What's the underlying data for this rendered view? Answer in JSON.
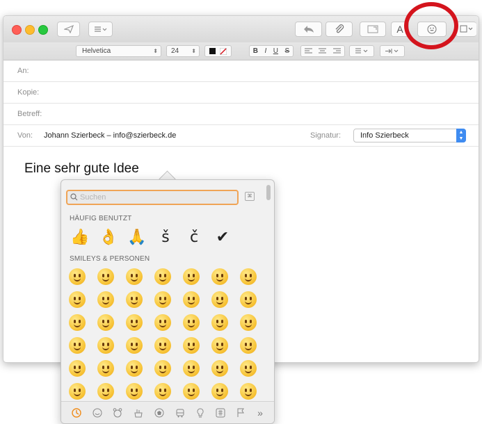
{
  "toolbar": {
    "send_icon": "paper-plane-icon",
    "header_fields_icon": "list-icon",
    "reply_icon": "reply-arrow-icon",
    "attach_icon": "paperclip-icon",
    "photo_icon": "photo-browser-icon",
    "format_label": "A",
    "emoji_icon": "smiley-icon",
    "more_icon": "photo-dropdown-icon"
  },
  "format": {
    "font": "Helvetica",
    "size": "24",
    "bold": "B",
    "italic": "I",
    "underline": "U"
  },
  "headers": {
    "to_label": "An:",
    "cc_label": "Kopie:",
    "subject_label": "Betreff:",
    "from_label": "Von:",
    "from_value": "Johann Szierbeck – info@szierbeck.de",
    "signature_label": "Signatur:",
    "signature_value": "Info Szierbeck"
  },
  "body": {
    "text": "Eine sehr gute Idee"
  },
  "picker": {
    "search_placeholder": "Suchen",
    "frequent_title": "HÄUFIG BENUTZT",
    "frequent": [
      "👍",
      "👌",
      "🙏",
      "š",
      "č",
      "✔"
    ],
    "smileys_title": "SMILEYS & PERSONEN",
    "categories": [
      "recent",
      "smileys",
      "animals",
      "food",
      "activity",
      "travel",
      "objects",
      "symbols",
      "flags",
      "more"
    ]
  },
  "colors": {
    "highlight_ring": "#d4141d",
    "search_focus": "#f0a456",
    "accent": "#3f8cf1"
  }
}
